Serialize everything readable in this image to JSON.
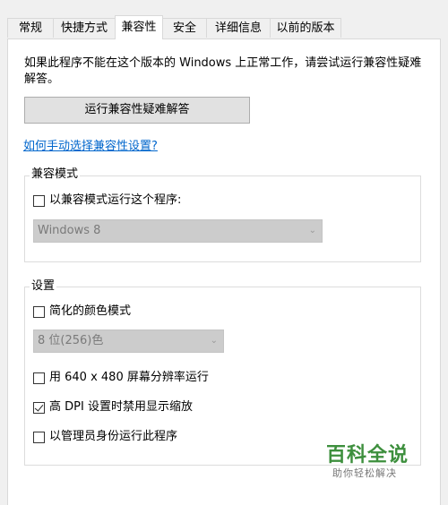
{
  "tabs": [
    {
      "label": "常规"
    },
    {
      "label": "快捷方式"
    },
    {
      "label": "兼容性"
    },
    {
      "label": "安全"
    },
    {
      "label": "详细信息"
    },
    {
      "label": "以前的版本"
    }
  ],
  "intro_text": "如果此程序不能在这个版本的 Windows 上正常工作，请尝试运行兼容性疑难解答。",
  "troubleshooter_button": "运行兼容性疑难解答",
  "help_link": "如何手动选择兼容性设置?",
  "compat_mode": {
    "legend": "兼容模式",
    "checkbox_label": "以兼容模式运行这个程序:",
    "checked": false,
    "select_value": "Windows 8"
  },
  "settings": {
    "legend": "设置",
    "reduced_color": {
      "label": "简化的颜色模式",
      "checked": false
    },
    "color_select_value": "8 位(256)色",
    "resolution_640": {
      "label": "用 640 x 480 屏幕分辨率运行",
      "checked": false
    },
    "high_dpi": {
      "label": "高 DPI 设置时禁用显示缩放",
      "checked": true
    },
    "run_as_admin": {
      "label": "以管理员身份运行此程序",
      "checked": false
    }
  },
  "watermark": {
    "title": "百科全说",
    "subtitle": "助你轻松解决"
  }
}
